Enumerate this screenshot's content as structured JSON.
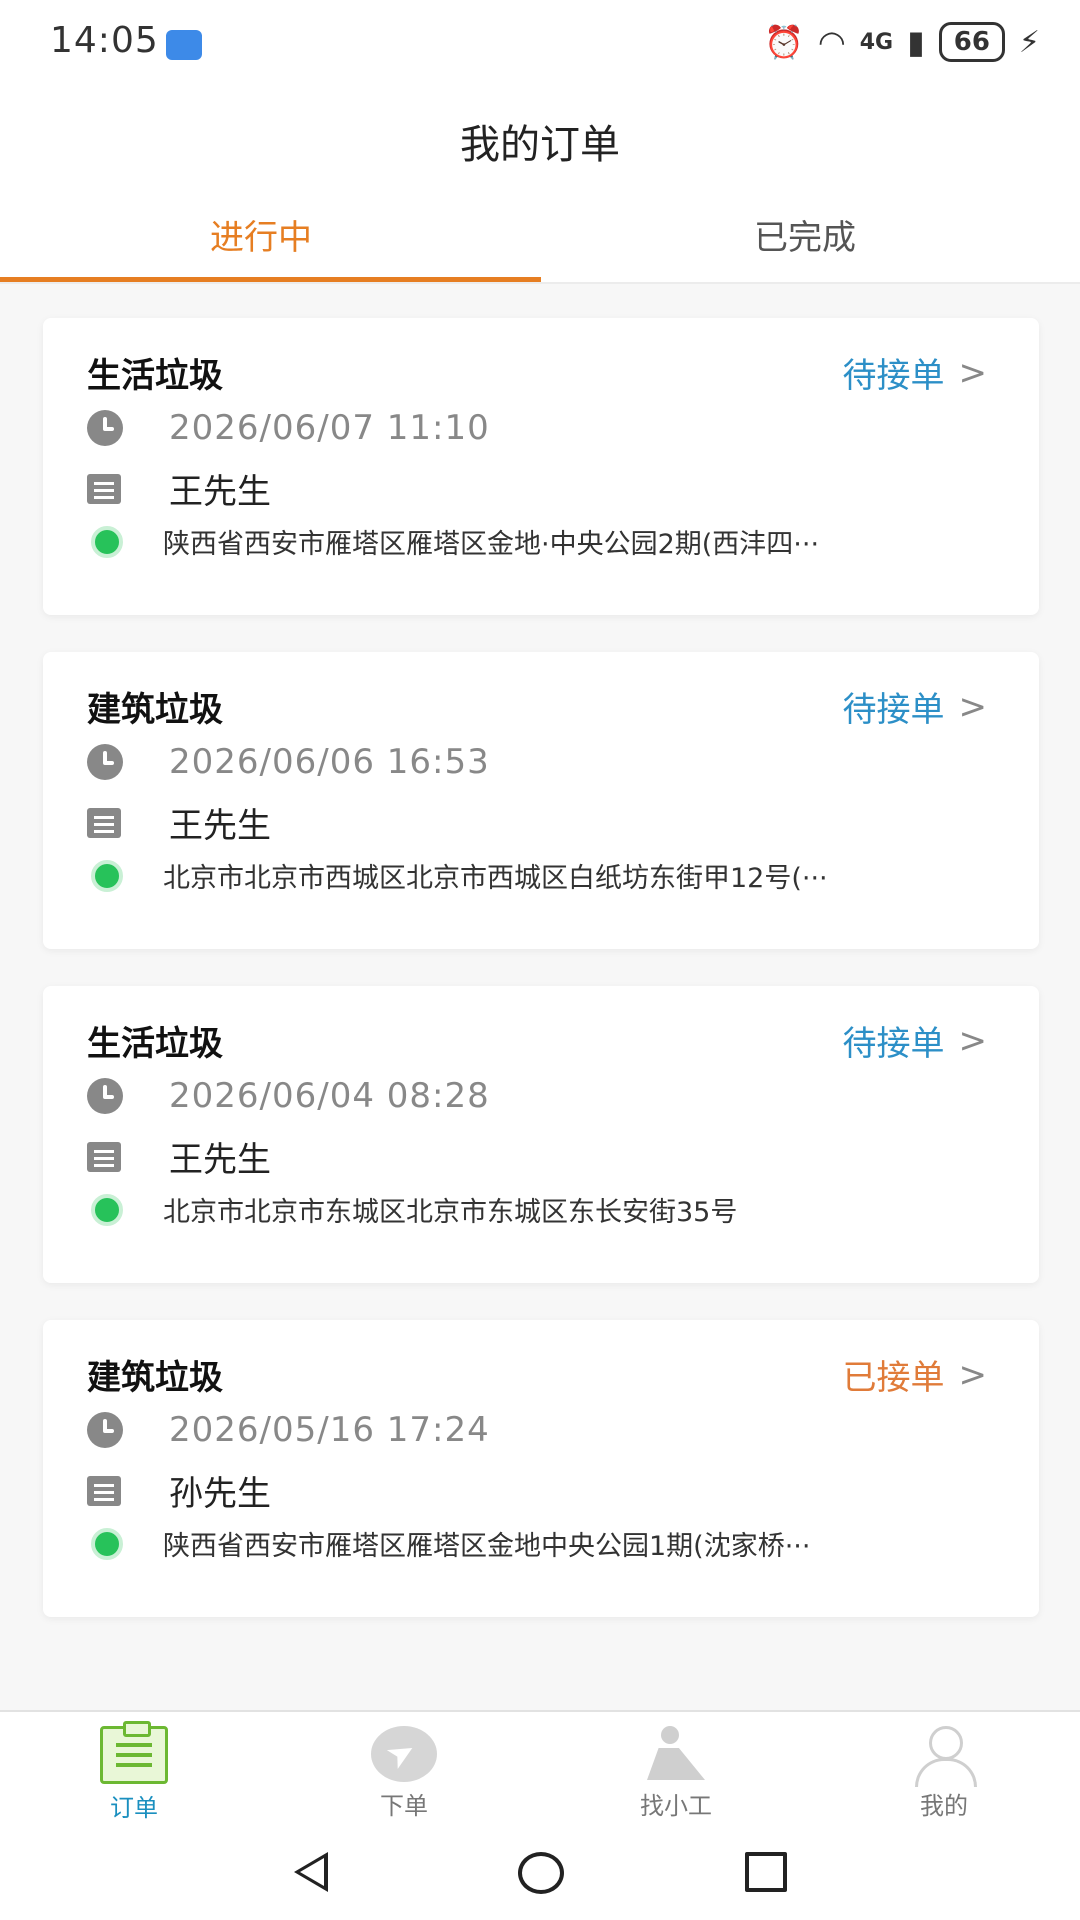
{
  "status_bar": {
    "time": "14:05",
    "network": "4G",
    "battery": "66",
    "icons": [
      "usb-icon",
      "alarm-icon",
      "wifi-icon",
      "signal-icon",
      "battery-icon",
      "charging-icon"
    ]
  },
  "header": {
    "title": "我的订单"
  },
  "tabs": [
    {
      "label": "进行中",
      "active": true
    },
    {
      "label": "已完成",
      "active": false
    }
  ],
  "accent_color": "#e67e22",
  "orders": [
    {
      "title": "生活垃圾",
      "status": "待接单",
      "status_color": "#2c8fc7",
      "time": "2026/06/07 11:10",
      "name": "王先生",
      "address": "陕西省西安市雁塔区雁塔区金地·中央公园2期(西沣四···"
    },
    {
      "title": "建筑垃圾",
      "status": "待接单",
      "status_color": "#2c8fc7",
      "time": "2026/06/06 16:53",
      "name": "王先生",
      "address": "北京市北京市西城区北京市西城区白纸坊东街甲12号(···"
    },
    {
      "title": "生活垃圾",
      "status": "待接单",
      "status_color": "#2c8fc7",
      "time": "2026/06/04 08:28",
      "name": "王先生",
      "address": "北京市北京市东城区北京市东城区东长安街35号"
    },
    {
      "title": "建筑垃圾",
      "status": "已接单",
      "status_color": "#e07b39",
      "time": "2026/05/16 17:24",
      "name": "孙先生",
      "address": "陕西省西安市雁塔区雁塔区金地中央公园1期(沈家桥···"
    }
  ],
  "bottom_nav": [
    {
      "label": "订单",
      "icon": "orders-icon",
      "active": true
    },
    {
      "label": "下单",
      "icon": "send-icon",
      "active": false
    },
    {
      "label": "找小工",
      "icon": "worker-icon",
      "active": false
    },
    {
      "label": "我的",
      "icon": "profile-icon",
      "active": false
    }
  ]
}
